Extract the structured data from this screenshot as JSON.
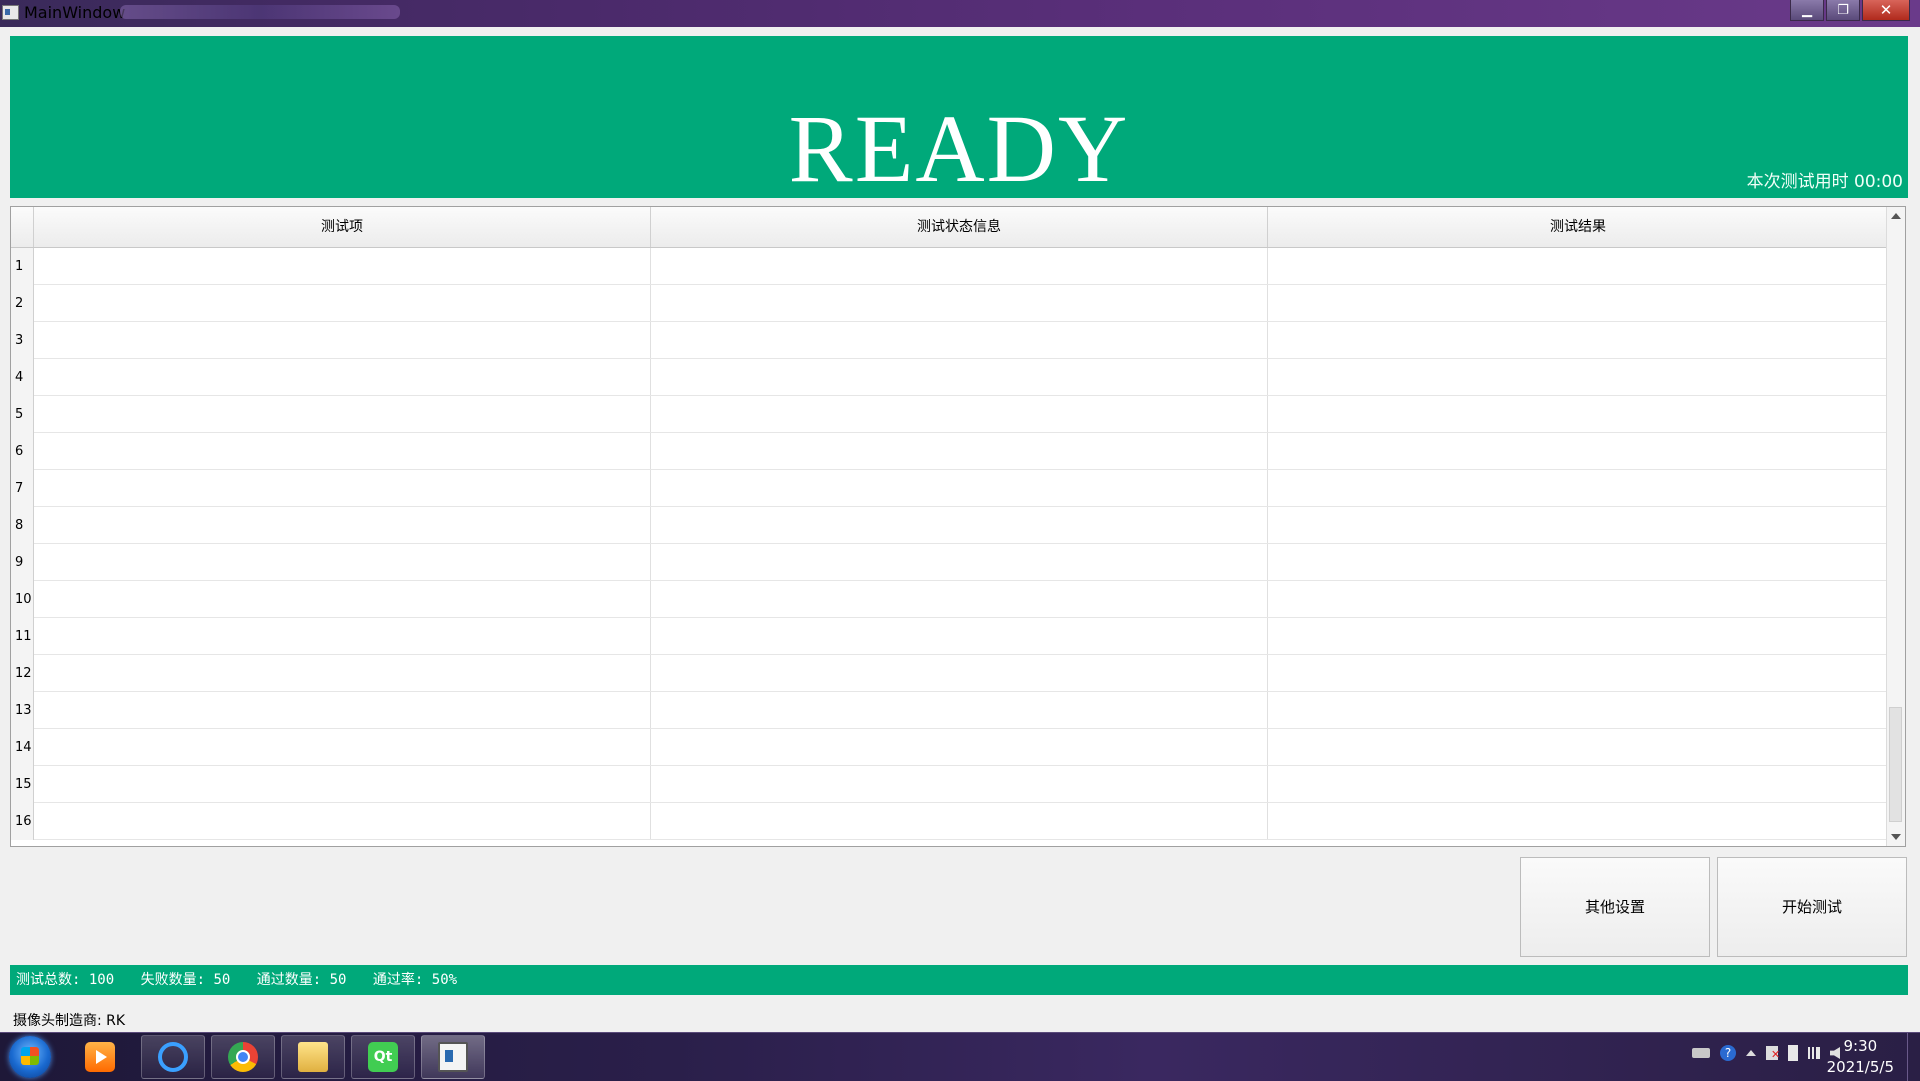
{
  "window": {
    "title": "MainWindow",
    "minimize_glyph": "▁",
    "maximize_glyph": "❐",
    "close_glyph": "✕"
  },
  "banner": {
    "status": "READY",
    "elapsed_label": "本次测试用时 00:00",
    "color": "#00a97a"
  },
  "table": {
    "columns": [
      "测试项",
      "测试状态信息",
      "测试结果"
    ],
    "row_numbers": [
      "1",
      "2",
      "3",
      "4",
      "5",
      "6",
      "7",
      "8",
      "9",
      "10",
      "11",
      "12",
      "13",
      "14",
      "15",
      "16"
    ]
  },
  "buttons": {
    "other_settings": "其他设置",
    "start_test": "开始测试"
  },
  "stats": {
    "total": "测试总数: 100",
    "failed": "失败数量: 50",
    "passed": "通过数量: 50",
    "pass_rate": "通过率: 50%"
  },
  "vendor": "摄像头制造商: RK",
  "taskbar": {
    "apps": [
      "media-player-icon",
      "qq-browser-icon",
      "chrome-icon",
      "file-explorer-icon",
      "qt-creator-icon",
      "main-window-app-icon"
    ],
    "tray_help": "?",
    "time": "9:30",
    "date": "2021/5/5"
  }
}
